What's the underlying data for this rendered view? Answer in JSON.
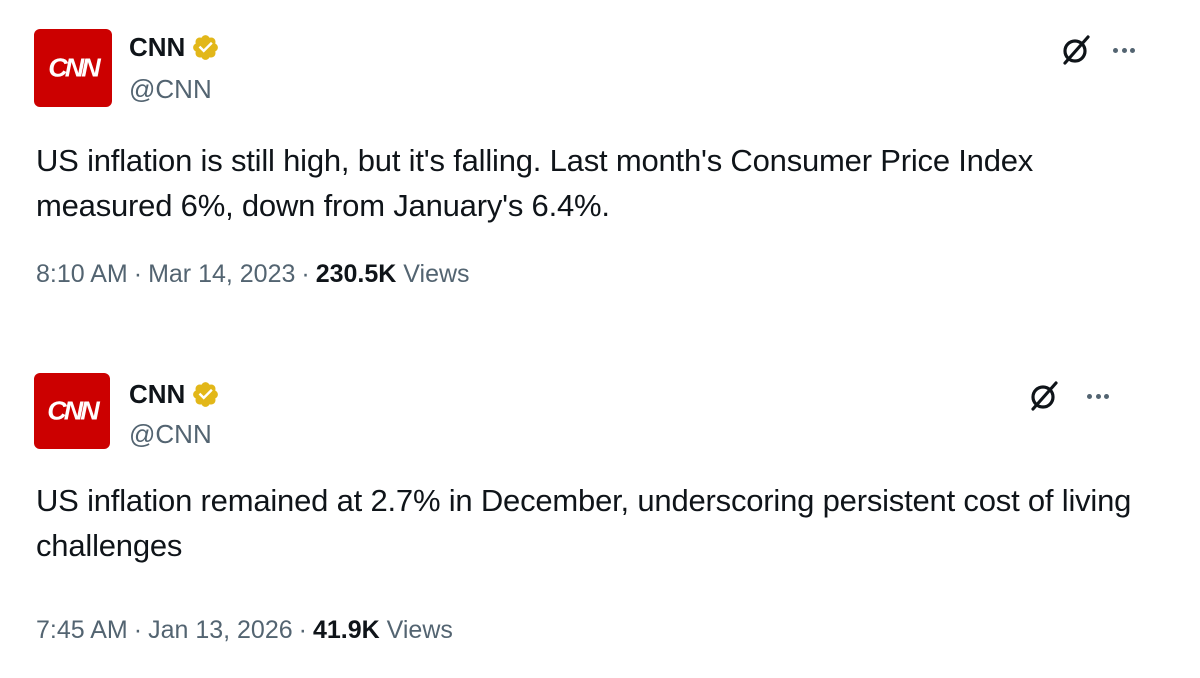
{
  "tweets": [
    {
      "author": {
        "name": "CNN",
        "handle": "@CNN",
        "avatar_text": "CNN",
        "verified": true
      },
      "text": "US inflation is still high, but it's falling. Last month's Consumer Price Index measured 6%, down from January's 6.4%.",
      "time": "8:10 AM",
      "date": "Mar 14, 2023",
      "views_count": "230.5K",
      "views_label": "Views",
      "separator": "·",
      "actions": {
        "grok_icon": "grok-icon",
        "more_icon": "more-icon"
      }
    },
    {
      "author": {
        "name": "CNN",
        "handle": "@CNN",
        "avatar_text": "CNN",
        "verified": true
      },
      "text": "US inflation remained at 2.7% in December, underscoring persistent cost of living challenges",
      "time": "7:45 AM",
      "date": "Jan 13, 2026",
      "views_count": "41.9K",
      "views_label": "Views",
      "separator": "·",
      "actions": {
        "grok_icon": "grok-icon",
        "more_icon": "more-icon"
      }
    }
  ],
  "colors": {
    "brand_red": "#cc0000",
    "verified_gold": "#e2b719",
    "text_primary": "#0f1419",
    "text_secondary": "#536471"
  }
}
